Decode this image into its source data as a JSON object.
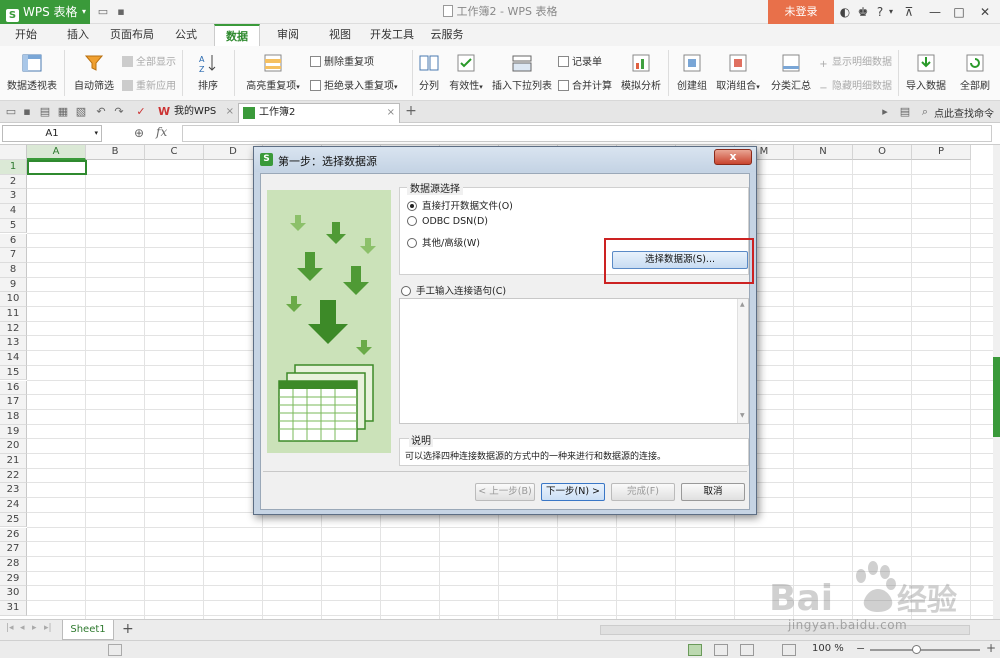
{
  "app": {
    "name": "WPS 表格",
    "window_title": "工作簿2 - WPS 表格",
    "login_label": "未登录",
    "help_label": "?"
  },
  "menu": {
    "tabs": [
      {
        "label": "开始"
      },
      {
        "label": "插入"
      },
      {
        "label": "页面布局"
      },
      {
        "label": "公式"
      },
      {
        "label": "数据",
        "active": true
      },
      {
        "label": "审阅"
      },
      {
        "label": "视图"
      },
      {
        "label": "开发工具"
      },
      {
        "label": "云服务"
      }
    ]
  },
  "ribbon": {
    "pivot": "数据透视表",
    "autofilter": "自动筛选",
    "show_all": "全部显示",
    "reapply": "重新应用",
    "sort": "排序",
    "highlight_dup": "高亮重复项",
    "remove_dup": "删除重复项",
    "reject_dup": "拒绝录入重复项",
    "split": "分列",
    "validity": "有效性",
    "insert_dropdown": "插入下拉列表",
    "record": "记录单",
    "consolidate": "合并计算",
    "whatif": "模拟分析",
    "create_group": "创建组",
    "ungroup": "取消组合",
    "subtotal": "分类汇总",
    "show_detail": "显示明细数据",
    "hide_detail": "隐藏明细数据",
    "import_data": "导入数据",
    "refresh_all": "全部刷"
  },
  "doc_tabs": [
    {
      "label": "我的WPS"
    },
    {
      "label": "工作簿2",
      "active": true
    }
  ],
  "find_command": "点此查找命令",
  "formula_bar": {
    "name_box": "A1",
    "fx": "fx"
  },
  "grid": {
    "columns": [
      "A",
      "B",
      "C",
      "D",
      "E",
      "F",
      "G",
      "H",
      "I",
      "J",
      "K",
      "L",
      "M",
      "N",
      "O",
      "P"
    ],
    "rows": [
      "1",
      "2",
      "3",
      "4",
      "5",
      "6",
      "7",
      "8",
      "9",
      "10",
      "11",
      "12",
      "13",
      "14",
      "15",
      "16",
      "17",
      "18",
      "19",
      "20",
      "21",
      "22",
      "23",
      "24",
      "25",
      "26",
      "27",
      "28",
      "29",
      "30",
      "31"
    ]
  },
  "sheet_tabs": [
    {
      "label": "Sheet1"
    }
  ],
  "status": {
    "zoom": "100 %"
  },
  "dialog": {
    "title": "第一步：选择数据源",
    "close_label": "x",
    "group_title": "数据源选择",
    "option_direct": "直接打开数据文件(O)",
    "option_odbc": "ODBC DSN(D)",
    "option_other": "其他/高级(W)",
    "select_source_button": "选择数据源(S)...",
    "option_manual": "手工输入连接语句(C)",
    "desc_title": "说明",
    "desc_text": "可以选择四种连接数据源的方式中的一种来进行和数据源的连接。",
    "btn_prev": "< 上一步(B)",
    "btn_next": "下一步(N) >",
    "btn_finish": "完成(F)",
    "btn_cancel": "取消"
  },
  "watermark": {
    "brand": "Baidu经验",
    "url": "jingyan.baidu.com"
  },
  "colors": {
    "accent": "#3a9a3a",
    "login": "#e8704a",
    "highlight": "#cc2222"
  }
}
